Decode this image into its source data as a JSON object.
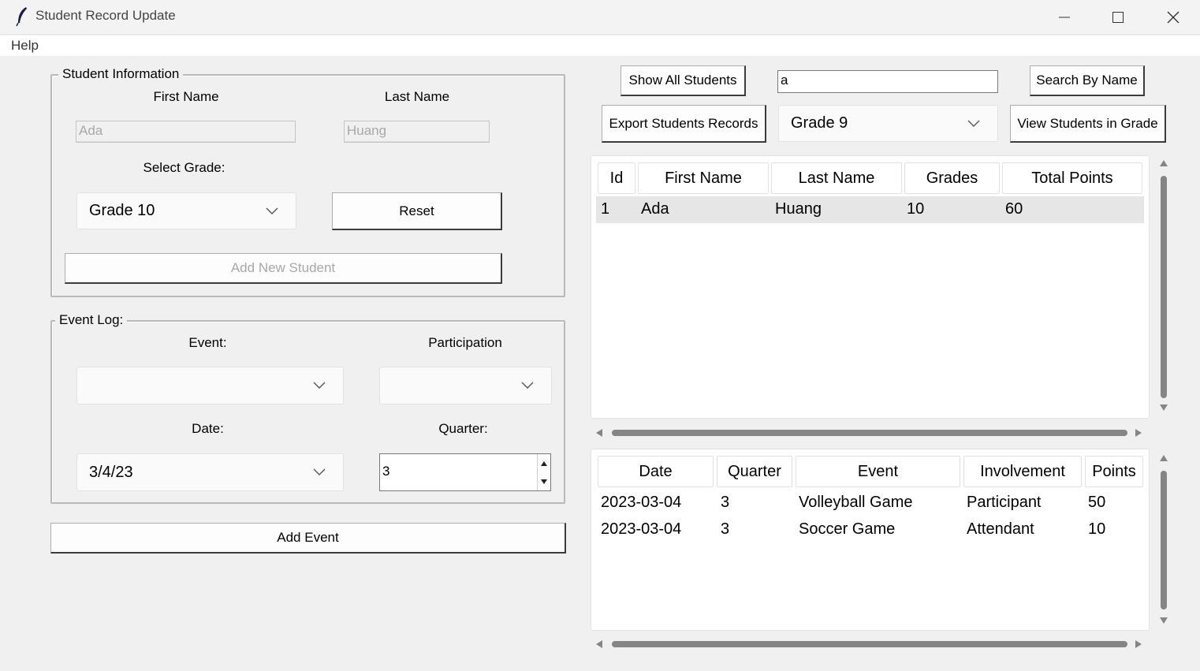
{
  "window": {
    "title": "Student Record Update",
    "minimize": "—",
    "maximize": "☐",
    "close": "✕"
  },
  "menu": {
    "help": "Help"
  },
  "student_info": {
    "frame_title": "Student Information",
    "first_name_label": "First Name",
    "last_name_label": "Last Name",
    "first_name_value": "Ada",
    "last_name_value": "Huang",
    "select_grade_label": "Select Grade:",
    "grade_value": "Grade 10",
    "reset_label": "Reset",
    "add_student_label": "Add New Student"
  },
  "event_log": {
    "frame_title": "Event Log:",
    "event_label": "Event:",
    "participation_label": "Participation",
    "event_value": "",
    "participation_value": "",
    "date_label": "Date:",
    "quarter_label": "Quarter:",
    "date_value": "3/4/23",
    "quarter_value": "3",
    "add_event_label": "Add Event"
  },
  "toolbar": {
    "show_all_label": "Show All Students",
    "search_value": "a",
    "search_by_name_label": "Search By Name",
    "export_label": "Export Students Records",
    "grade_filter_value": "Grade 9",
    "view_in_grade_label": "View Students in Grade"
  },
  "students_table": {
    "columns": [
      "Id",
      "First Name",
      "Last Name",
      "Grades",
      "Total Points"
    ],
    "rows": [
      [
        "1",
        "Ada",
        "Huang",
        "10",
        "60"
      ]
    ]
  },
  "events_table": {
    "columns": [
      "Date",
      "Quarter",
      "Event",
      "Involvement",
      "Points"
    ],
    "rows": [
      [
        "2023-03-04",
        "3",
        "Volleyball Game",
        "Participant",
        "50"
      ],
      [
        "2023-03-04",
        "3",
        "Soccer Game",
        "Attendant",
        "10"
      ]
    ]
  }
}
